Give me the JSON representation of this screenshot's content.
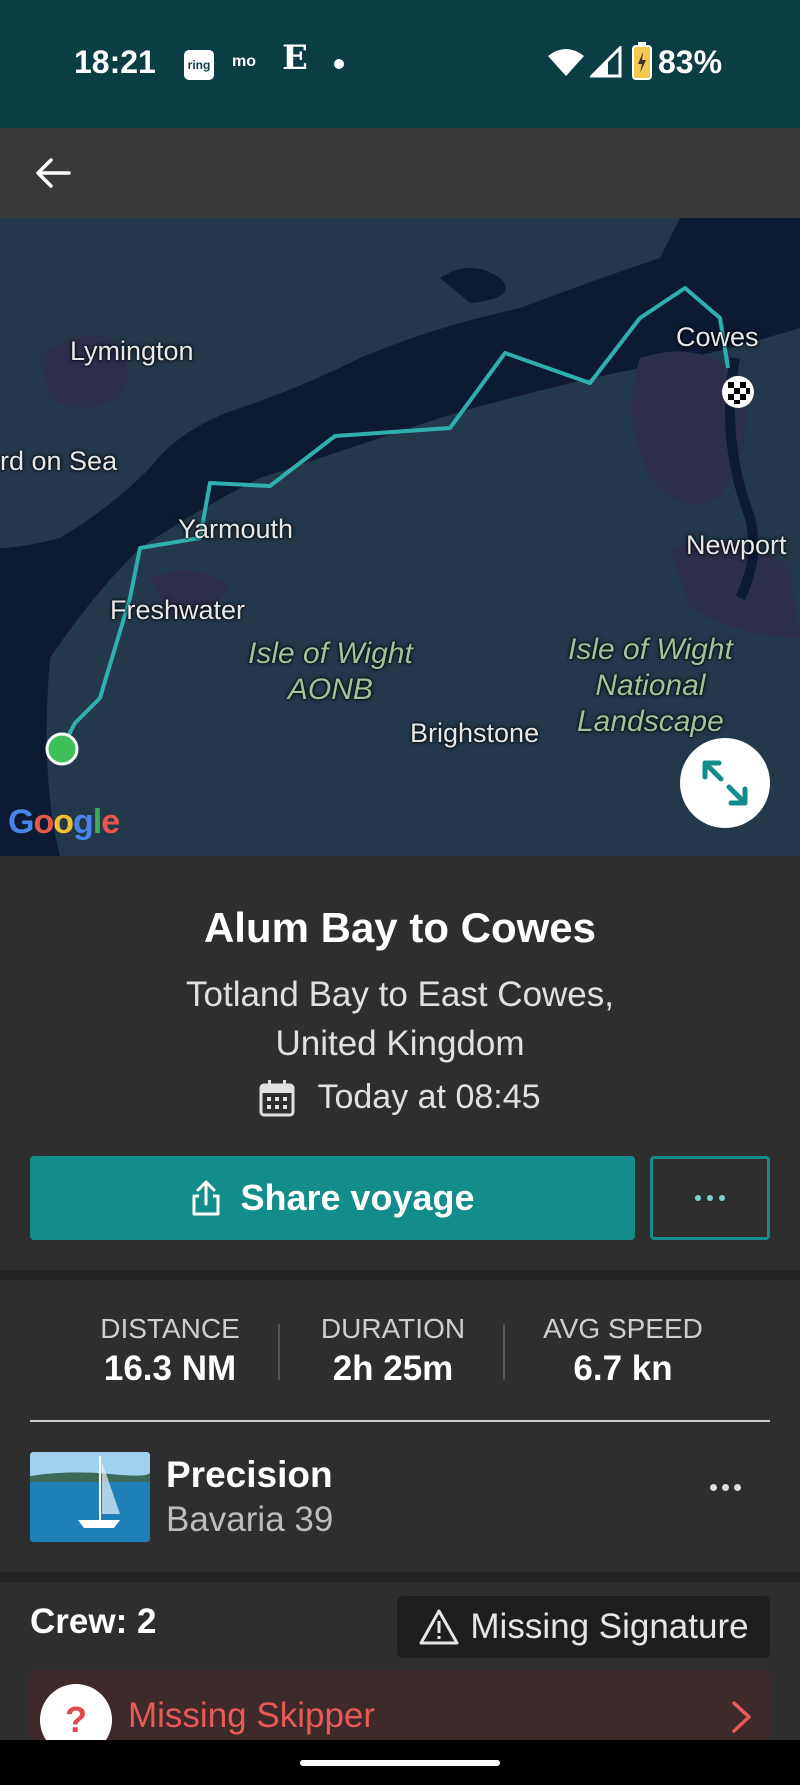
{
  "status_bar": {
    "time": "18:21",
    "notifications": [
      "ring",
      "mo",
      "E"
    ],
    "battery": "83%"
  },
  "map": {
    "labels": {
      "lymington": "Lymington",
      "milford": "rd on Sea",
      "yarmouth": "Yarmouth",
      "freshwater": "Freshwater",
      "cowes": "Cowes",
      "newport": "Newport",
      "brighstone": "Brighstone",
      "aonb": "Isle of Wight\nAONB",
      "national_landscape": "Isle of Wight\nNational\nLandscape"
    },
    "attribution": "Google",
    "route_color": "#2fb0b0",
    "start_marker_color": "#3fbf5a"
  },
  "voyage": {
    "title": "Alum Bay to Cowes",
    "subtitle": "Totland Bay to East Cowes, United Kingdom",
    "date": "Today at 08:45",
    "share_label": "Share voyage"
  },
  "stats": [
    {
      "label": "DISTANCE",
      "value": "16.3 NM"
    },
    {
      "label": "DURATION",
      "value": "2h 25m"
    },
    {
      "label": "AVG SPEED",
      "value": "6.7 kn"
    }
  ],
  "boat": {
    "name": "Precision",
    "model": "Bavaria 39"
  },
  "crew": {
    "title": "Crew: 2",
    "signature_badge": "Missing Signature",
    "skipper_label": "Missing Skipper",
    "skipper_icon": "?"
  },
  "colors": {
    "accent": "#138c8c",
    "status_bar": "#0b3d45",
    "warning_red": "#e85a55"
  }
}
